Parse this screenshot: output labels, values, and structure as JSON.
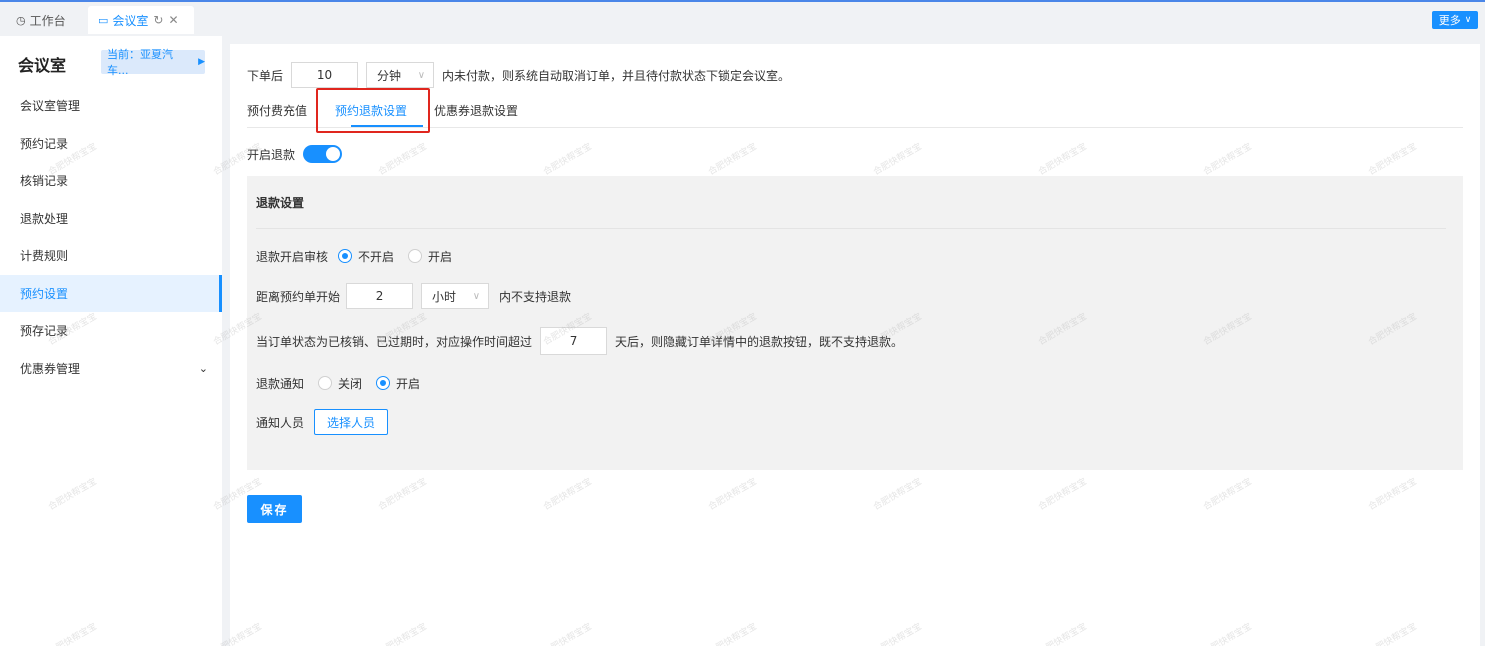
{
  "tabs_bar": {
    "home_tab": "工作台",
    "active_tab": "会议室",
    "more_label": "更多"
  },
  "sidebar": {
    "title": "会议室",
    "store_badge": "当前：亚夏汽车...",
    "items": [
      {
        "label": "会议室管理"
      },
      {
        "label": "预约记录"
      },
      {
        "label": "核销记录"
      },
      {
        "label": "退款处理"
      },
      {
        "label": "计费规则"
      },
      {
        "label": "预约设置"
      },
      {
        "label": "预存记录"
      },
      {
        "label": "优惠券管理"
      }
    ],
    "active_item": "预约设置"
  },
  "order_rule": {
    "prefix": "下单后",
    "value": "10",
    "unit": "分钟",
    "suffix": "内未付款，则系统自动取消订单，并且待付款状态下锁定会议室。"
  },
  "sub_tabs": [
    "预付费充值",
    "预约退款设置",
    "优惠券退款设置"
  ],
  "active_sub_tab": "预约退款设置",
  "refund_toggle": {
    "label": "开启退款",
    "enabled": true
  },
  "refund_settings": {
    "title": "退款设置",
    "audit": {
      "label": "退款开启审核",
      "options": [
        "不开启",
        "开启"
      ],
      "selected": "不开启"
    },
    "before_start": {
      "prefix": "距离预约单开始",
      "value": "2",
      "unit": "小时",
      "suffix": "内不支持退款"
    },
    "hide_button": {
      "prefix": "当订单状态为已核销、已过期时，对应操作时间超过",
      "value": "7",
      "suffix": "天后，则隐藏订单详情中的退款按钮，既不支持退款。"
    },
    "notify": {
      "label": "退款通知",
      "options": [
        "关闭",
        "开启"
      ],
      "selected": "开启"
    },
    "notify_people": {
      "label": "通知人员",
      "button": "选择人员"
    }
  },
  "save_label": "保存",
  "watermark": "合肥快帮宝宝",
  "colors": {
    "primary": "#1890ff",
    "highlight": "#e0261e"
  }
}
